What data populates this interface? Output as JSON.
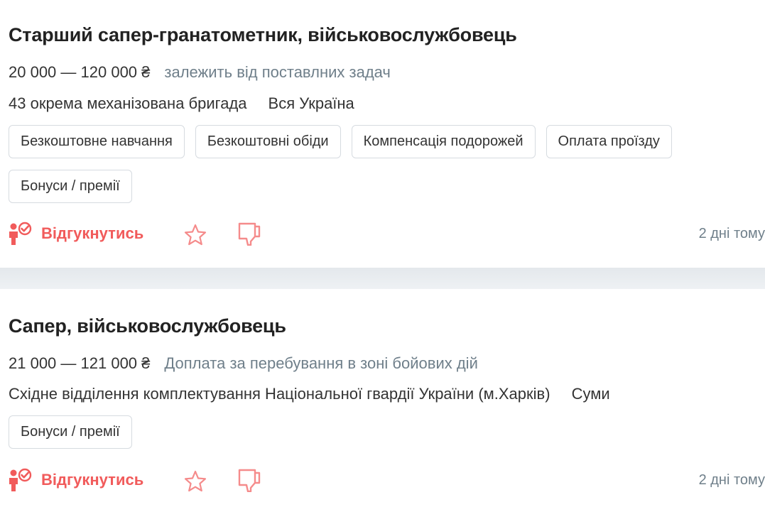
{
  "colors": {
    "accent": "#f15b5b",
    "muted": "#6f7f8a",
    "tag_border": "#d6dbe0",
    "divider": "#e4e8ec"
  },
  "vacancies": [
    {
      "title": "Старший сапер-гранатометник, військовослужбовець",
      "salary": "20 000 — 120 000 ₴",
      "salary_note": "залежить від поставлних задач",
      "company": "43 окрема механізована бригада",
      "location": "Вся Україна",
      "tags": [
        "Безкоштовне навчання",
        "Безкоштовні обіди",
        "Компенсація подорожей",
        "Оплата проїзду",
        "Бонуси / премії"
      ],
      "apply_label": "Відгукнутись",
      "posted": "2 дні тому",
      "icons": {
        "apply": "person-check-icon",
        "favorite": "star-icon",
        "dislike": "thumbs-down-icon"
      }
    },
    {
      "title": "Сапер, військовослужбовець",
      "salary": "21 000 — 121 000 ₴",
      "salary_note": "Доплата за перебування в зоні бойових дій",
      "company": "Східне відділення комплектування Національної гвардії України (м.Харків)",
      "location": "Суми",
      "tags": [
        "Бонуси / премії"
      ],
      "apply_label": "Відгукнутись",
      "posted": "2 дні тому",
      "icons": {
        "apply": "person-check-icon",
        "favorite": "star-icon",
        "dislike": "thumbs-down-icon"
      }
    }
  ]
}
